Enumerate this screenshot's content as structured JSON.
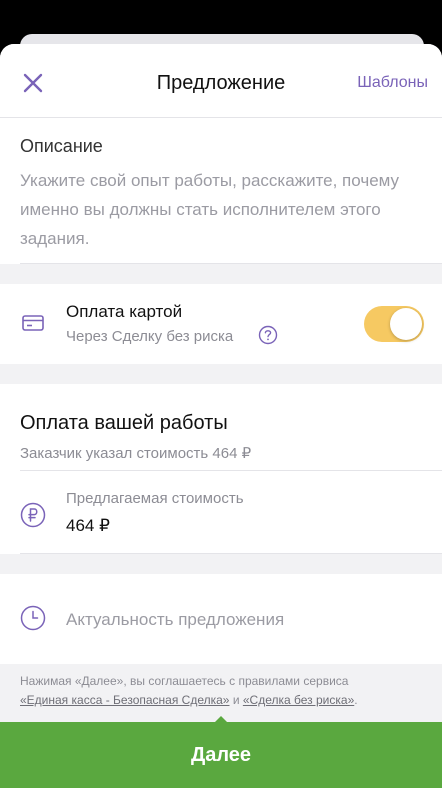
{
  "header": {
    "title": "Предложение",
    "templates_label": "Шаблоны"
  },
  "description": {
    "label": "Описание",
    "placeholder": "Укажите свой опыт работы, расскажите, почему именно вы должны стать исполнителем этого задания."
  },
  "card_payment": {
    "title": "Оплата картой",
    "subtitle": "Через Сделку без риска",
    "enabled": true,
    "toggle_color": "#f6c962"
  },
  "work_payment": {
    "title": "Оплата вашей работы",
    "client_price_text": "Заказчик указал стоимость 464 ₽",
    "proposed_price_label": "Предлагаемая стоимость",
    "proposed_price_value": "464 ₽"
  },
  "relevance": {
    "label": "Актуальность предложения"
  },
  "terms": {
    "prefix": "Нажимая «Далее», вы соглашаетесь с правилами сервиса",
    "link1": "«Единая касса - Безопасная Сделка»",
    "middle": "и",
    "link2": "«Сделка без риска»",
    "suffix": "."
  },
  "footer": {
    "next_label": "Далее",
    "button_color": "#5aa83f"
  },
  "icons": {
    "close": "close-icon",
    "card": "credit-card-icon",
    "help": "question-icon",
    "ruble": "ruble-icon",
    "clock": "clock-icon"
  },
  "colors": {
    "accent": "#7a63b8"
  }
}
